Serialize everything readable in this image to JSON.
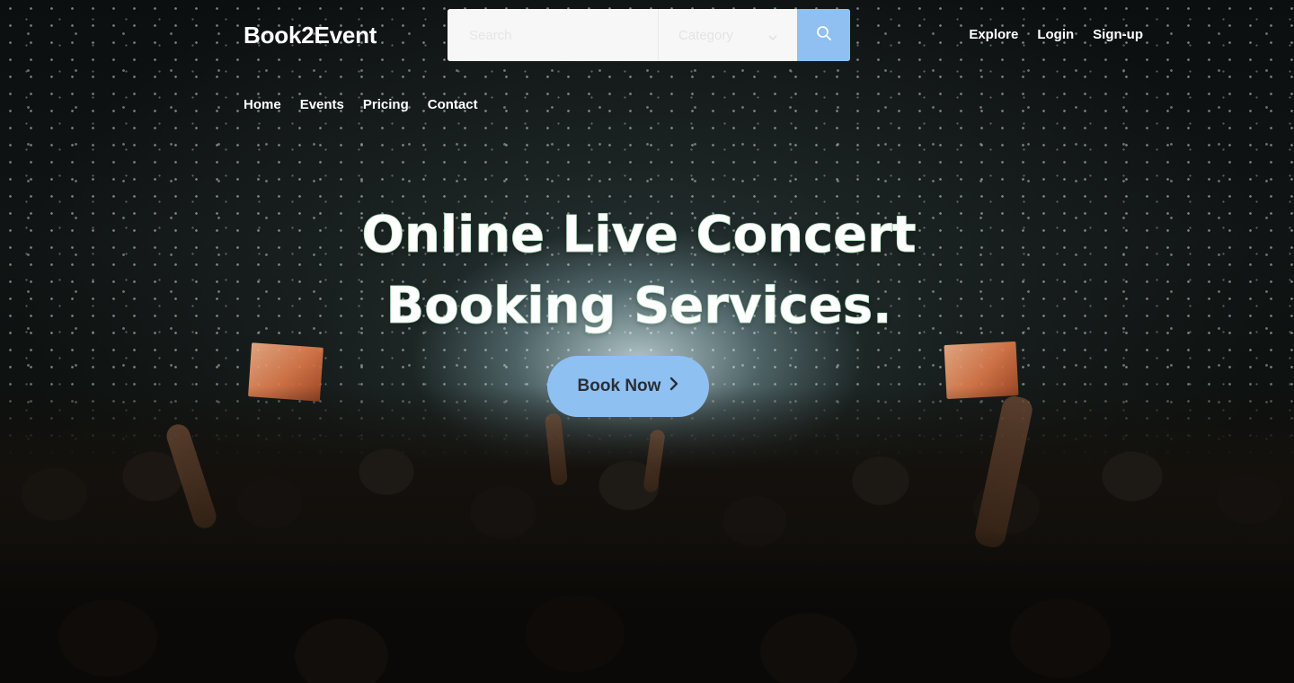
{
  "brand": {
    "name": "Book2Event"
  },
  "search": {
    "placeholder": "Search",
    "category_label": "Category",
    "button_icon": "search-icon"
  },
  "top_nav": {
    "items": [
      {
        "label": "Explore"
      },
      {
        "label": "Login"
      },
      {
        "label": "Sign-up"
      }
    ]
  },
  "main_nav": {
    "items": [
      {
        "label": "Home"
      },
      {
        "label": "Events"
      },
      {
        "label": "Pricing"
      },
      {
        "label": "Contact"
      }
    ]
  },
  "hero": {
    "title_line1": "Online Live Concert",
    "title_line2": "Booking Services.",
    "cta_label": "Book Now",
    "cta_icon": "chevron-right-icon"
  },
  "colors": {
    "accent": "#90c0f2",
    "cta_text": "#2a2f36",
    "title_outline": "#b9e6c5"
  }
}
